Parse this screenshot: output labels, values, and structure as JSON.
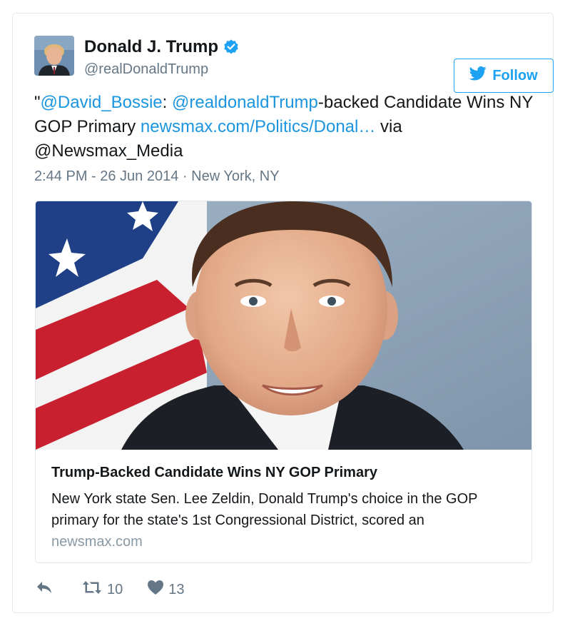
{
  "user": {
    "name": "Donald J. Trump",
    "handle": "@realDonaldTrump"
  },
  "follow": {
    "label": "Follow"
  },
  "tweet": {
    "quote_open": "\"",
    "mention_1": "@David_Bossie",
    "sep_1": ": ",
    "mention_2": "@realdonaldTrump",
    "text_1": "-backed Candidate Wins NY GOP Primary ",
    "link": "newsmax.com/Politics/Donal…",
    "text_2": " via @Newsmax_Media"
  },
  "meta": {
    "time": "2:44 PM - 26 Jun 2014",
    "separator": " · ",
    "location": "New York, NY"
  },
  "card": {
    "title": "Trump-Backed Candidate Wins NY GOP Primary",
    "description": "New York state Sen. Lee Zeldin, Donald Trump's choice in the GOP primary for the state's 1st Congressional District, scored an",
    "domain": "newsmax.com"
  },
  "actions": {
    "retweet_count": "10",
    "like_count": "13"
  },
  "colors": {
    "accent": "#1da1f2",
    "link": "#1b95e0",
    "muted": "#657786",
    "border": "#e1e8ed"
  },
  "icons": {
    "verified": "verified-badge-icon",
    "twitter": "twitter-bird-icon",
    "reply": "reply-icon",
    "retweet": "retweet-icon",
    "like": "heart-icon"
  }
}
